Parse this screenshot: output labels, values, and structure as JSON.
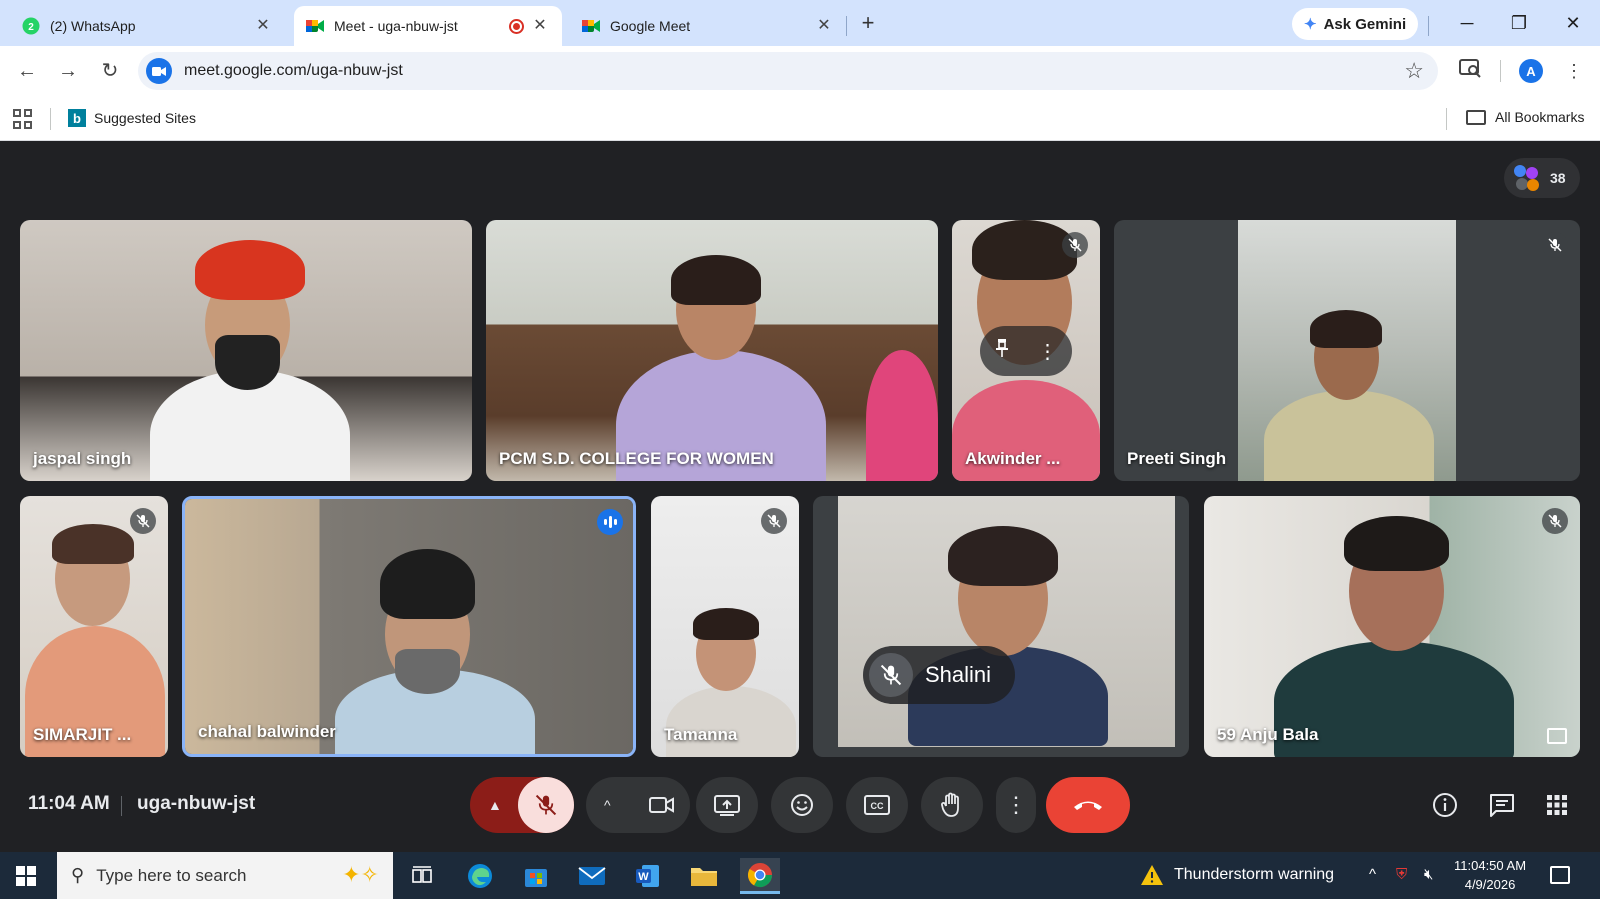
{
  "browser": {
    "tabs": [
      {
        "title": "(2) WhatsApp",
        "badge": "2",
        "active": false
      },
      {
        "title": "Meet - uga-nbuw-jst",
        "active": true,
        "recording": true
      },
      {
        "title": "Google Meet",
        "active": false
      }
    ],
    "gemini_label": "Ask Gemini",
    "url": "meet.google.com/uga-nbuw-jst",
    "profile_initial": "A",
    "bookmarks": {
      "suggested": "Suggested Sites",
      "all": "All Bookmarks"
    }
  },
  "meet": {
    "participant_count": "38",
    "tiles": [
      {
        "name": "jaspal singh",
        "muted": false
      },
      {
        "name": "PCM S.D. COLLEGE FOR WOMEN",
        "muted": false
      },
      {
        "name": "Akwinder ...",
        "muted": true
      },
      {
        "name": "Preeti Singh",
        "muted": true
      },
      {
        "name": "SIMARJIT ...",
        "muted": true
      },
      {
        "name": "chahal balwinder",
        "muted": false,
        "speaking": true
      },
      {
        "name": "Tamanna",
        "muted": true
      },
      {
        "name": "Shalini",
        "muted": true
      },
      {
        "name": "59 Anju Bala",
        "muted": true
      }
    ],
    "time": "11:04 AM",
    "meeting_code": "uga-nbuw-jst"
  },
  "taskbar": {
    "search_placeholder": "Type here to search",
    "weather": "Thunderstorm warning",
    "time": "11:04:50 AM",
    "date": "4/9/2026"
  },
  "colors": {
    "meet_bg": "#202124",
    "end_call": "#ea4335",
    "mic_muted": "#f9dedc",
    "accent": "#1a73e8"
  }
}
